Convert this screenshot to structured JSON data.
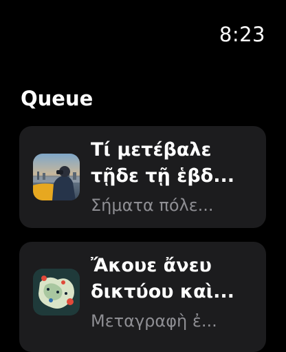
{
  "status": {
    "time": "8:23"
  },
  "header": {
    "title": "Queue"
  },
  "queue": [
    {
      "title_line1": "Τί μετέβαλε",
      "title_line2": "τῇδε τῇ ἑβδ...",
      "subtitle": "Σήματα πόλε...",
      "artwork": "city-person-photo"
    },
    {
      "title_line1": "Ἄκουε ἄνευ",
      "title_line2": "δικτύου καὶ...",
      "subtitle": "Μεταγραφὴ ἐ...",
      "artwork": "abstract-map-art"
    }
  ],
  "colors": {
    "background": "#000000",
    "card": "#1c1c1e",
    "secondary_text": "#8e8e93"
  }
}
